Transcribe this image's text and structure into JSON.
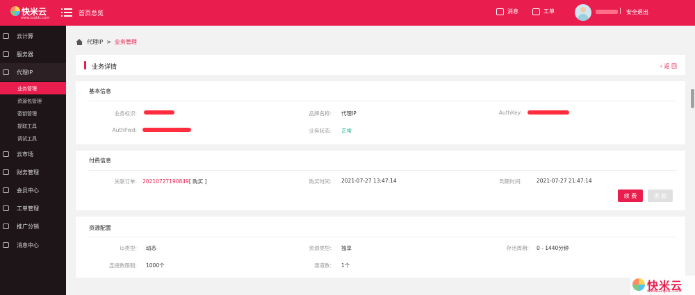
{
  "topbar": {
    "logo_text": "快米云",
    "logo_sub": "www.zzqidc.com",
    "home_link": "首页总览",
    "messages": "消息",
    "workorder": "工单",
    "separator": "|",
    "logout": "安全退出"
  },
  "sidebar": {
    "items": [
      {
        "label": "云计算",
        "icon": "cloud-icon"
      },
      {
        "label": "服务器",
        "icon": "server-icon"
      },
      {
        "label": "代理IP",
        "icon": "monitor-icon"
      },
      {
        "label": "云市场",
        "icon": "market-icon"
      },
      {
        "label": "财务管理",
        "icon": "finance-icon"
      },
      {
        "label": "会员中心",
        "icon": "user-icon"
      },
      {
        "label": "工单管理",
        "icon": "ticket-icon"
      },
      {
        "label": "推广分销",
        "icon": "share-icon"
      },
      {
        "label": "消息中心",
        "icon": "message-icon"
      }
    ],
    "sub_items": [
      "业务管理",
      "资源包管理",
      "密钥管理",
      "提取工具",
      "调试工具"
    ]
  },
  "breadcrumb": {
    "parent": "代理IP",
    "sep": ">",
    "current": "业务管理"
  },
  "page": {
    "title": "业务详情",
    "back": "返 回"
  },
  "basic": {
    "title": "基本信息",
    "id_label": "业务标识:",
    "brand_label": "品牌名称:",
    "brand_value": "代理IP",
    "authkey_label": "AuthKey:",
    "authpwd_label": "AuthPwd:",
    "status_label": "业务状态:",
    "status_value": "正常"
  },
  "billing": {
    "title": "付费信息",
    "order_label": "关联订单:",
    "order_value": "20210727190849",
    "order_tag": "[ 购买 ]",
    "buy_time_label": "购买时间:",
    "buy_time_value": "2021-07-27 13:47:14",
    "expire_label": "到期时间:",
    "expire_value": "2021-07-27 21:47:14",
    "renew_button": "续 费",
    "refund_button": "退 款"
  },
  "resource": {
    "title": "资源配置",
    "ip_type_label": "ip类型:",
    "ip_type_value": "动态",
    "res_type_label": "资源类型:",
    "res_type_value": "独享",
    "survival_label": "存活周期:",
    "survival_value": "0 - 1440分钟",
    "conn_label": "连接数限制:",
    "conn_value": "1000个",
    "channel_label": "通道数:",
    "channel_value": "1个"
  },
  "watermark": {
    "text": "快米云",
    "sub": "www.zzqidc.com"
  },
  "colors": {
    "brand": "#e91e4e",
    "sidebar": "#1e1518",
    "status_ok": "#19b394"
  }
}
